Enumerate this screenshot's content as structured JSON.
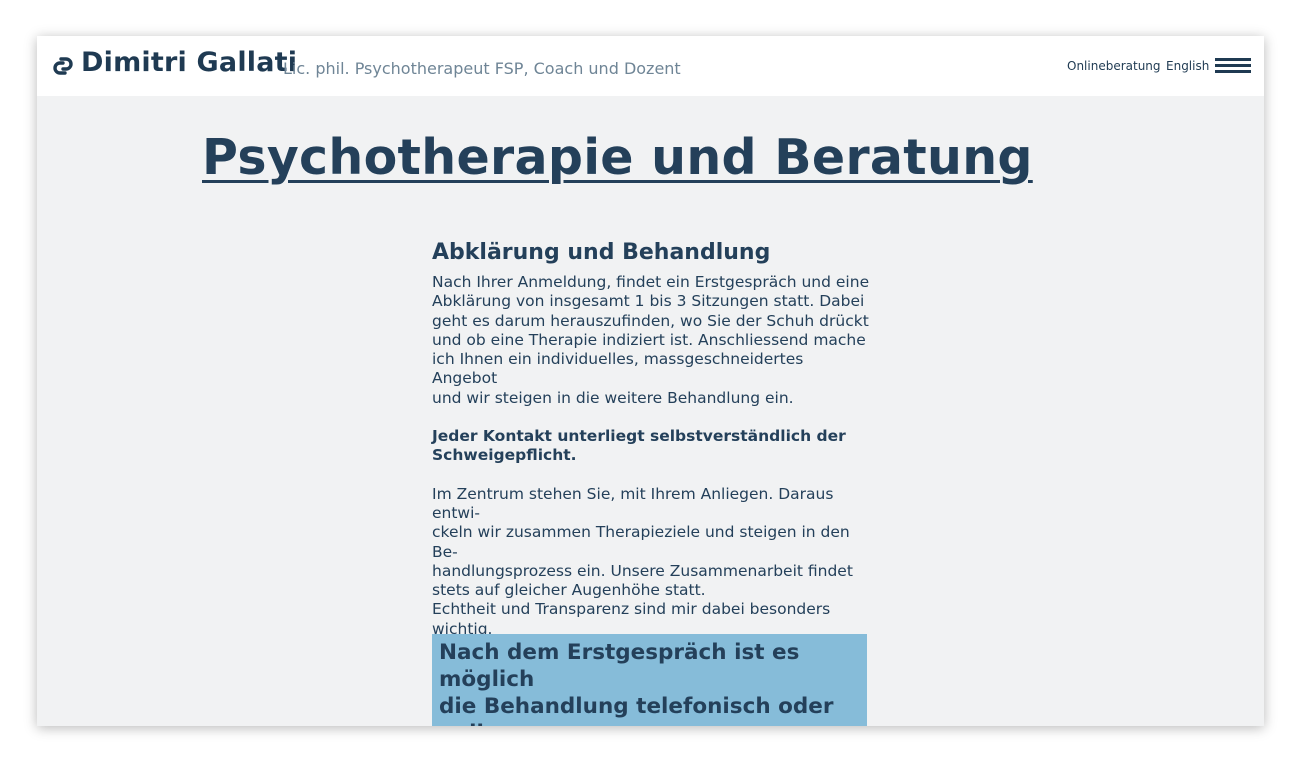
{
  "header": {
    "site_name": "Dimitri Gallati",
    "tagline": "Lic. phil. Psychotherapeut FSP, Coach und Dozent",
    "nav": {
      "online": "Onlineberatung",
      "language": "English"
    },
    "icons": {
      "logo": "logo-icon",
      "menu": "hamburger-menu-icon"
    }
  },
  "main": {
    "title": "Psychotherapie und Beratung",
    "section_title": "Abklärung und Behandlung",
    "paragraph1": "Nach Ihrer Anmeldung, findet ein Erstgespräch und eine\nAbklärung von insgesamt 1 bis 3 Sitzungen statt. Dabei\ngeht es darum herauszufinden, wo Sie der Schuh drückt\nund ob eine Therapie indiziert ist. Anschliessend mache\nich Ihnen ein individuelles, massgeschneidertes Angebot\nund wir steigen in die weitere Behandlung ein.",
    "paragraph2": "Jeder Kontakt unterliegt selbstverständlich der\nSchweigepflicht.",
    "paragraph3": "Im Zentrum stehen Sie, mit Ihrem Anliegen. Daraus entwi-\nckeln wir zusammen Therapieziele und steigen in den Be-\nhandlungsprozess ein. Unsere Zusammenarbeit findet\nstets auf gleicher Augenhöhe statt.\nEchtheit und Transparenz sind mir dabei besonders\nwichtig.",
    "highlight": "Nach dem Erstgespräch ist es möglich\ndie Behandlung telefonisch oder online\nweiterzuführen."
  },
  "colors": {
    "text": "#24405a",
    "background": "#f1f2f3",
    "header_bg": "#ffffff",
    "highlight_bg": "#86bcd9",
    "tagline": "#6f8596"
  }
}
